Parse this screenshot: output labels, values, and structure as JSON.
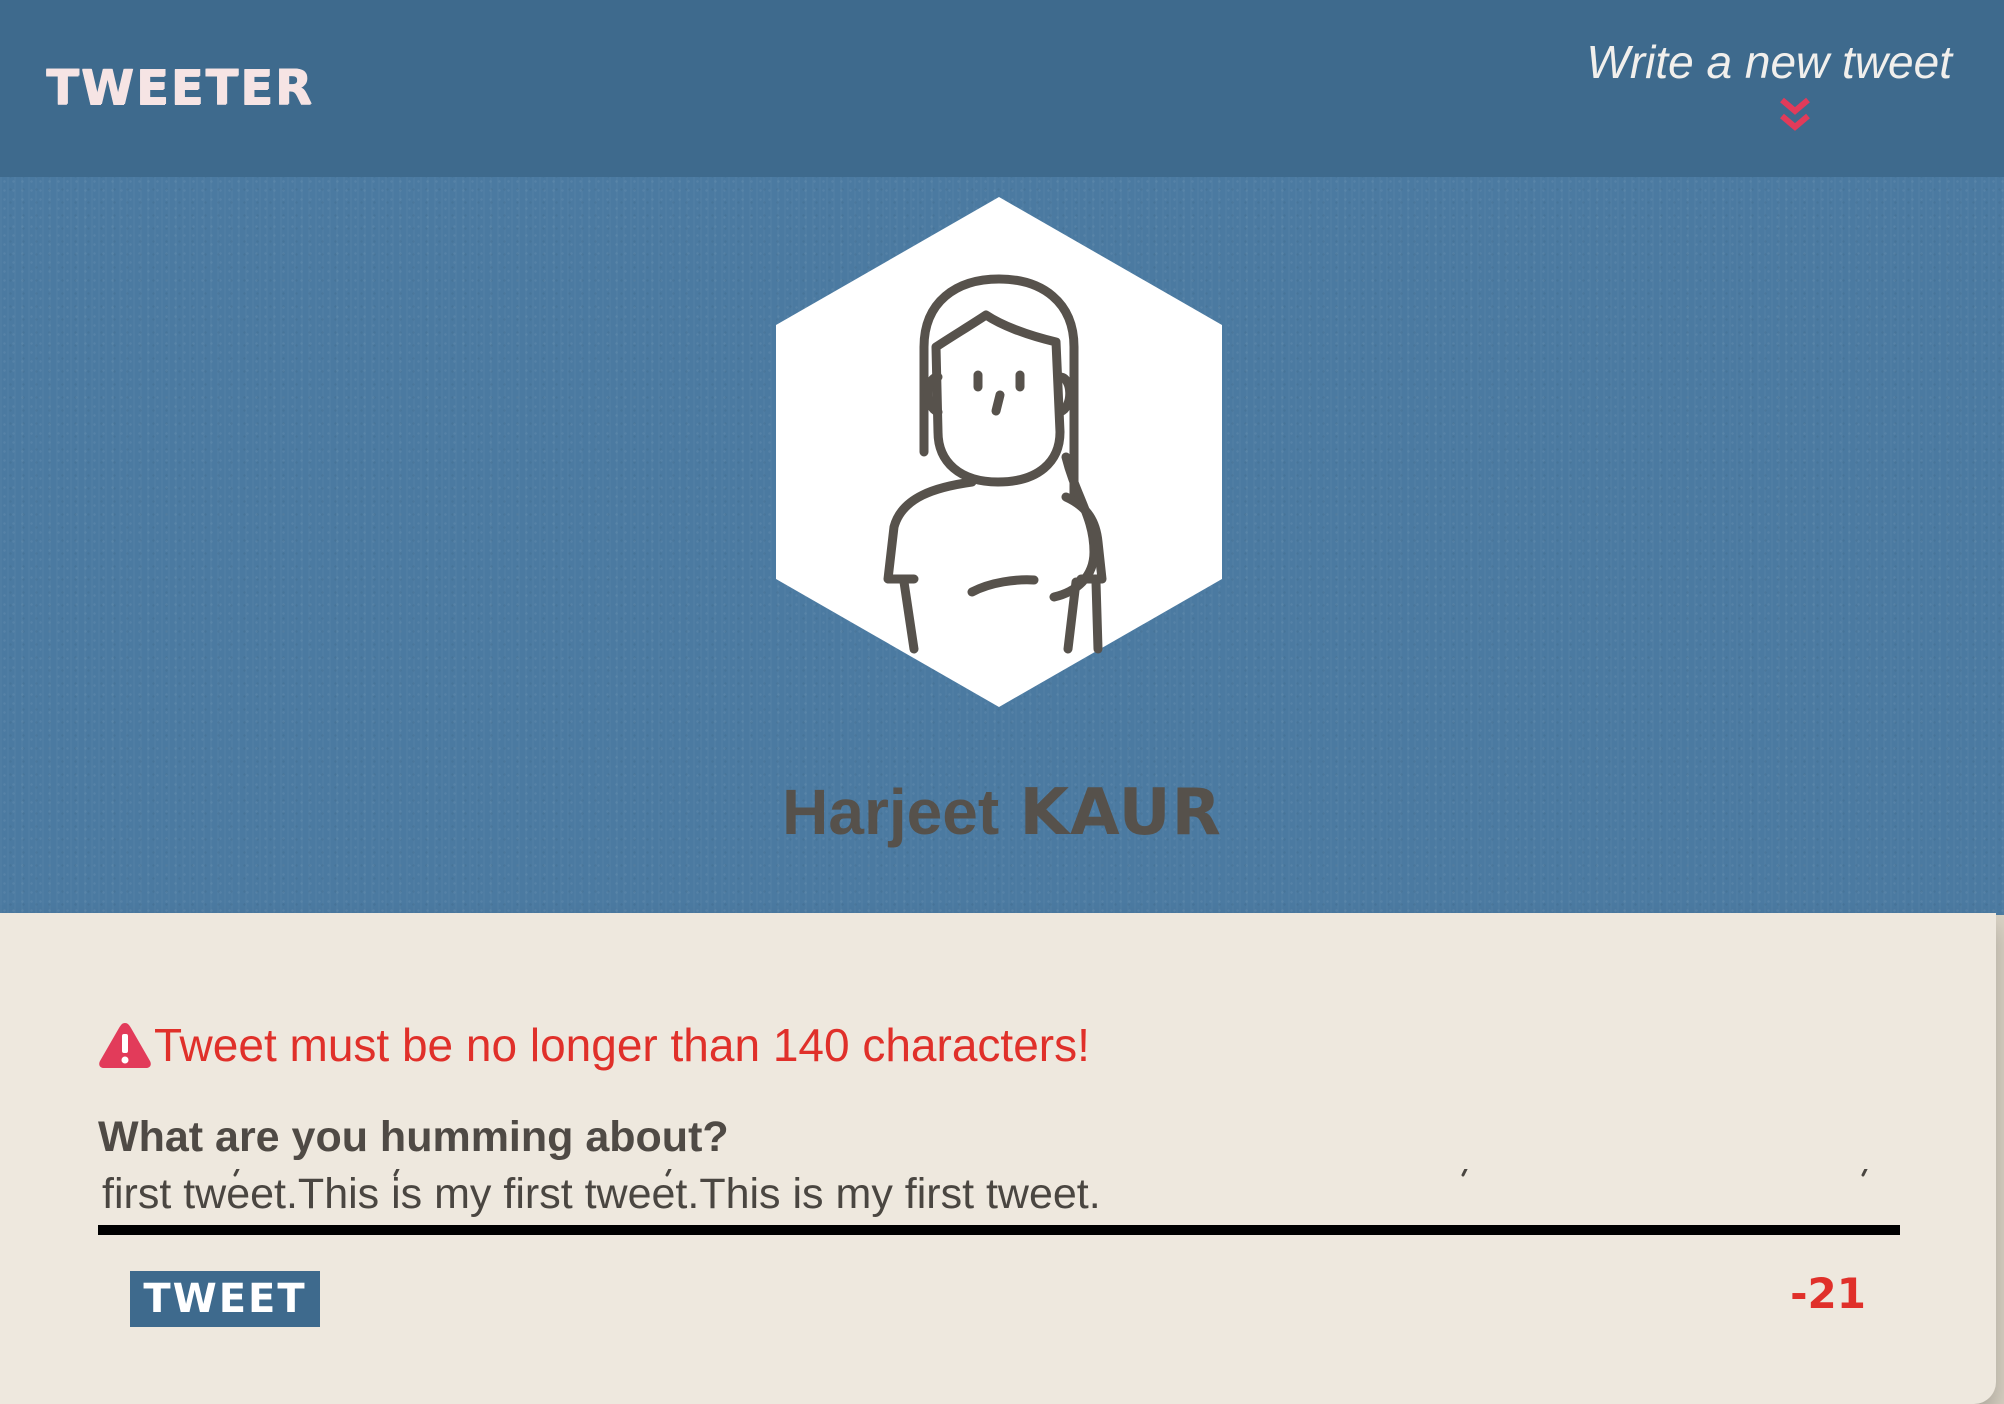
{
  "navbar": {
    "brand": "TWEETER",
    "compose_toggle_label": "Write a new tweet",
    "compose_toggle_icon": "double-chevron-down-icon"
  },
  "profile": {
    "avatar_icon": "woman-avatar-icon",
    "first_name": "Harjeet",
    "last_name": "KAUR"
  },
  "compose": {
    "error_icon": "warning-icon",
    "error_message": "Tweet must be no longer than 140 characters!",
    "prompt_label": "What are you humming about?",
    "textarea_value": "first tweet.This is my first tweet.This is my first tweet.",
    "submit_label": "TWEET",
    "char_counter": "-21"
  },
  "colors": {
    "navbar": "#3e6a8d",
    "hero": "#4b7aa1",
    "card": "#eee8de",
    "error": "#e0302a",
    "accent_pink": "#e23b5a",
    "text_dark": "#56514b"
  }
}
